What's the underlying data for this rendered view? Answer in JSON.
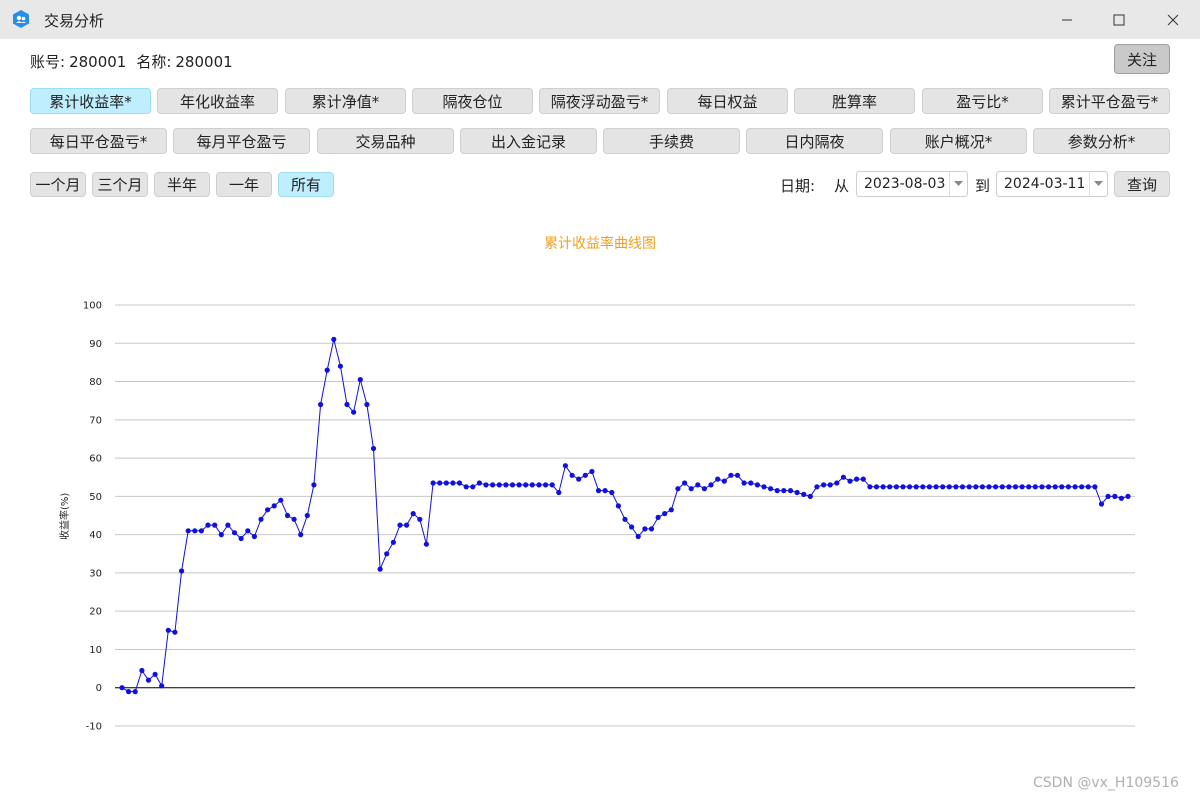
{
  "window": {
    "title": "交易分析"
  },
  "account": {
    "id_label": "账号:",
    "id_value": "280001",
    "name_label": "名称:",
    "name_value": "280001"
  },
  "follow_label": "关注",
  "tabs_row1": [
    {
      "label": "累计收益率*",
      "active": true
    },
    {
      "label": "年化收益率",
      "active": false
    },
    {
      "label": "累计净值*",
      "active": false
    },
    {
      "label": "隔夜仓位",
      "active": false
    },
    {
      "label": "隔夜浮动盈亏*",
      "active": false
    },
    {
      "label": "每日权益",
      "active": false
    },
    {
      "label": "胜算率",
      "active": false
    },
    {
      "label": "盈亏比*",
      "active": false
    },
    {
      "label": "累计平仓盈亏*",
      "active": false
    }
  ],
  "tabs_row2": [
    {
      "label": "每日平仓盈亏*",
      "active": false
    },
    {
      "label": "每月平仓盈亏",
      "active": false
    },
    {
      "label": "交易品种",
      "active": false
    },
    {
      "label": "出入金记录",
      "active": false
    },
    {
      "label": "手续费",
      "active": false
    },
    {
      "label": "日内隔夜",
      "active": false
    },
    {
      "label": "账户概况*",
      "active": false
    },
    {
      "label": "参数分析*",
      "active": false
    }
  ],
  "ranges": [
    {
      "label": "一个月",
      "active": false
    },
    {
      "label": "三个月",
      "active": false
    },
    {
      "label": "半年",
      "active": false
    },
    {
      "label": "一年",
      "active": false
    },
    {
      "label": "所有",
      "active": true
    }
  ],
  "date_filter": {
    "label": "日期:",
    "from_label": "从",
    "from_value": "2023-08-03",
    "to_label": "到",
    "to_value": "2024-03-11",
    "query_label": "查询"
  },
  "watermark": "CSDN @vx_H109516",
  "colors": {
    "accent_active": "#bfeeff",
    "line": "#1010e0",
    "title": "#f0a020"
  },
  "chart_data": {
    "type": "line",
    "title": "累计收益率曲线图",
    "ylabel": "收益率(%)",
    "ylim": [
      -10,
      100
    ],
    "yticks": [
      100,
      90,
      80,
      70,
      60,
      50,
      40,
      30,
      20,
      10,
      0,
      -10
    ],
    "grid": true,
    "series": [
      {
        "values": [
          0,
          -1,
          -1,
          4.5,
          2,
          3.5,
          0.5,
          15,
          14.5,
          30.5,
          41,
          41,
          41,
          42.5,
          42.5,
          40,
          42.5,
          40.5,
          39,
          41,
          39.5,
          44,
          46.5,
          47.5,
          49,
          45,
          44,
          40,
          45,
          53,
          74,
          83,
          91,
          84,
          74,
          72,
          80.5,
          74,
          62.5,
          31,
          35,
          38,
          42.5,
          42.5,
          45.5,
          44,
          37.5,
          53.5,
          53.5,
          53.5,
          53.5,
          53.5,
          52.5,
          52.5,
          53.5,
          53,
          53,
          53,
          53,
          53,
          53,
          53,
          53,
          53,
          53,
          53,
          51,
          58,
          55.5,
          54.5,
          55.5,
          56.5,
          51.5,
          51.5,
          51,
          47.5,
          44,
          42,
          39.5,
          41.5,
          41.5,
          44.5,
          45.5,
          46.5,
          52,
          53.5,
          52,
          53,
          52,
          53,
          54.5,
          54,
          55.5,
          55.5,
          53.5,
          53.5,
          53,
          52.5,
          52,
          51.5,
          51.5,
          51.5,
          51,
          50.5,
          50,
          52.5,
          53,
          53,
          53.5,
          55,
          54,
          54.5,
          54.5,
          52.5,
          52.5,
          52.5,
          52.5,
          52.5,
          52.5,
          52.5,
          52.5,
          52.5,
          52.5,
          52.5,
          52.5,
          52.5,
          52.5,
          52.5,
          52.5,
          52.5,
          52.5,
          52.5,
          52.5,
          52.5,
          52.5,
          52.5,
          52.5,
          52.5,
          52.5,
          52.5,
          52.5,
          52.5,
          52.5,
          52.5,
          52.5,
          52.5,
          52.5,
          52.5,
          48,
          50,
          50,
          49.5,
          50
        ]
      }
    ]
  }
}
